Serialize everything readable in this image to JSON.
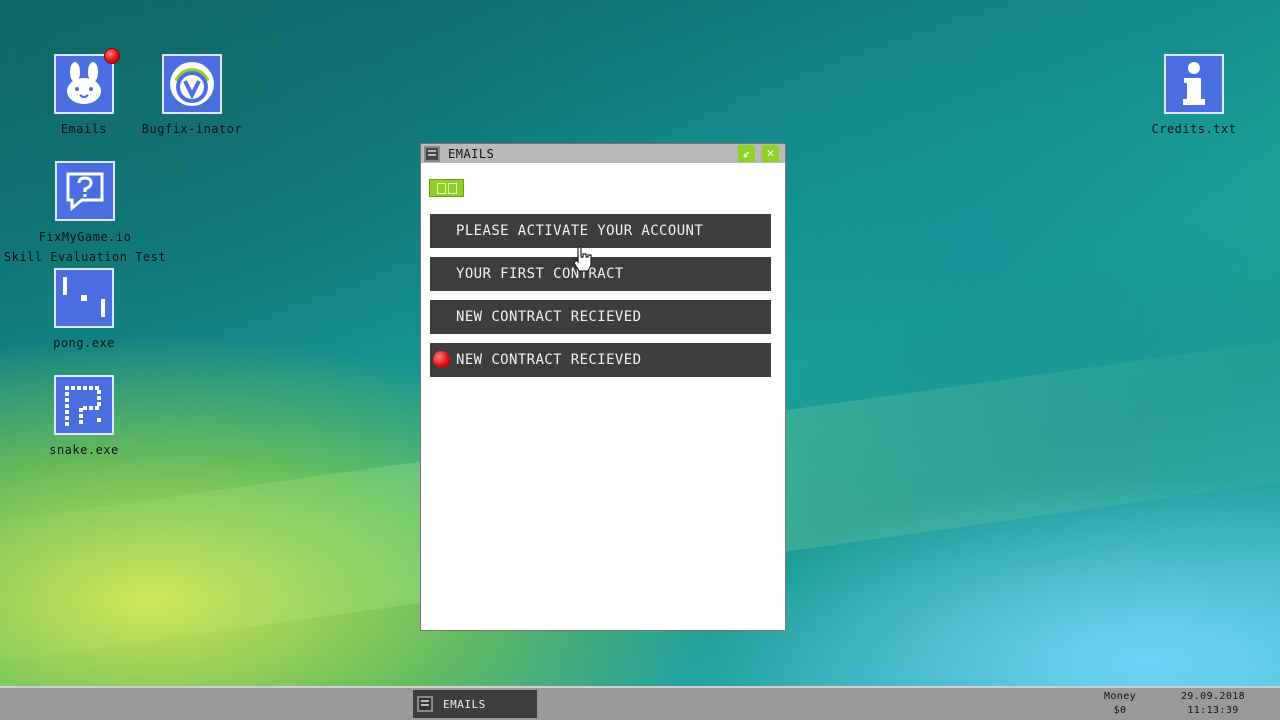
{
  "desktop": {
    "icons": [
      {
        "label": "Emails"
      },
      {
        "label": "Bugfix-inator"
      },
      {
        "label": "FixMyGame.io\nSkill Evaluation Test"
      },
      {
        "label": "pong.exe"
      },
      {
        "label": "snake.exe"
      },
      {
        "label": "Credits.txt"
      }
    ]
  },
  "window": {
    "title": "EMAILS",
    "minimize_glyph": "↙",
    "close_glyph": "✕",
    "emails": [
      {
        "subject": "PLEASE ACTIVATE YOUR ACCOUNT",
        "unread": false
      },
      {
        "subject": "YOUR FIRST CONTRACT",
        "unread": false
      },
      {
        "subject": "NEW CONTRACT RECIEVED",
        "unread": false
      },
      {
        "subject": "NEW CONTRACT RECIEVED",
        "unread": true
      }
    ]
  },
  "taskbar": {
    "task_label": "EMAILS",
    "money_label": "Money",
    "money_value": "$0",
    "date": "29.09.2018",
    "time": "11:13:39"
  },
  "colors": {
    "accent_green": "#8fd127",
    "icon_blue": "#4a6ee0",
    "email_row": "#3d3d3d",
    "notification_red": "#e01010"
  }
}
